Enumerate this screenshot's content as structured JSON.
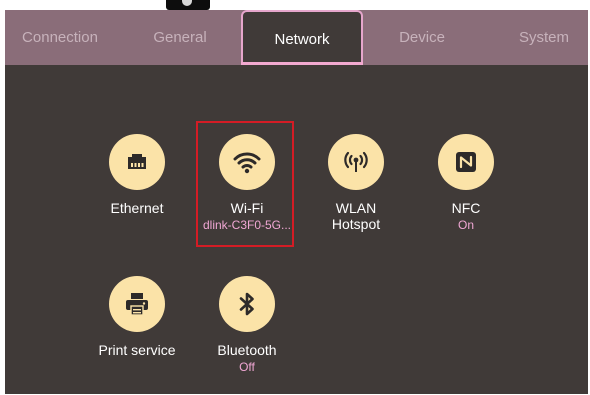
{
  "tabs": [
    {
      "label": "Connection"
    },
    {
      "label": "General"
    },
    {
      "label": "Network"
    },
    {
      "label": "Device"
    },
    {
      "label": "System"
    }
  ],
  "active_tab": "Network",
  "tiles": {
    "ethernet": {
      "label": "Ethernet",
      "icon": "ethernet-icon"
    },
    "wifi": {
      "label": "Wi-Fi",
      "status": "dlink-C3F0-5G...",
      "icon": "wifi-icon"
    },
    "wlan_hotspot": {
      "label_line1": "WLAN",
      "label_line2": "Hotspot",
      "icon": "hotspot-icon"
    },
    "nfc": {
      "label": "NFC",
      "status": "On",
      "icon": "nfc-icon"
    },
    "print_service": {
      "label": "Print service",
      "icon": "printer-icon"
    },
    "bluetooth": {
      "label": "Bluetooth",
      "status": "Off",
      "icon": "bluetooth-icon"
    }
  },
  "colors": {
    "background": "#403a38",
    "tabbar": "#8a6d79",
    "icon_circle": "#fbe3a8",
    "icon_glyph": "#2d2a29",
    "status_text": "#f0a7d4",
    "highlight_box": "#d41c25"
  }
}
